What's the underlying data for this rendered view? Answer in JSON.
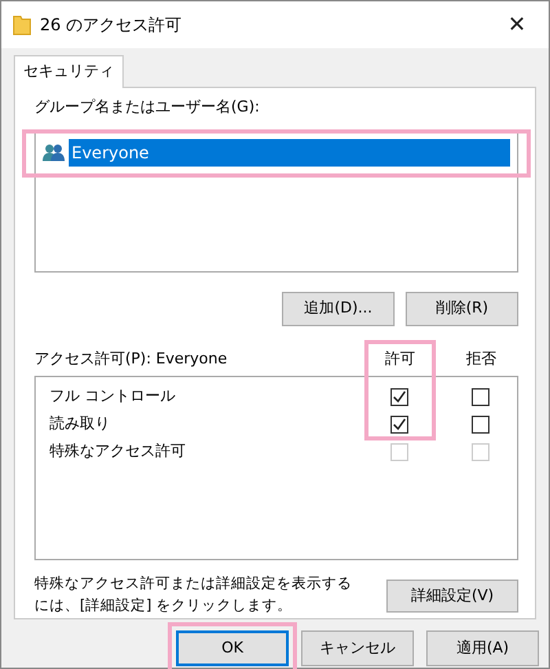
{
  "window": {
    "title": "26 のアクセス許可",
    "close": "✕"
  },
  "tabs": [
    {
      "label": "セキュリティ",
      "selected": true
    }
  ],
  "groups": {
    "label": "グループ名またはユーザー名(G):",
    "highlighted": true,
    "items": [
      {
        "name": "Everyone",
        "selected": true
      }
    ]
  },
  "group_buttons": [
    "追加(D)...",
    "削除(R)"
  ],
  "permissions": {
    "label": "アクセス許可(P): Everyone",
    "columns": [
      {
        "label": "許可",
        "highlighted": true
      },
      {
        "label": "拒否",
        "highlighted": false
      }
    ],
    "rows": [
      {
        "name": "フル コントロール",
        "allow": true,
        "deny": false,
        "disabled": false
      },
      {
        "name": "読み取り",
        "allow": true,
        "deny": false,
        "disabled": false
      },
      {
        "name": "特殊なアクセス許可",
        "allow": false,
        "deny": false,
        "disabled": true
      }
    ]
  },
  "advanced": {
    "text": "特殊なアクセス許可または詳細設定を表示するには、[詳細設定] をクリックします。",
    "button": "詳細設定(V)"
  },
  "buttons": [
    {
      "label": "OK",
      "default": true,
      "highlighted": true
    },
    {
      "label": "キャンセル",
      "default": false,
      "highlighted": false
    },
    {
      "label": "適用(A)",
      "default": false,
      "highlighted": false
    }
  ]
}
